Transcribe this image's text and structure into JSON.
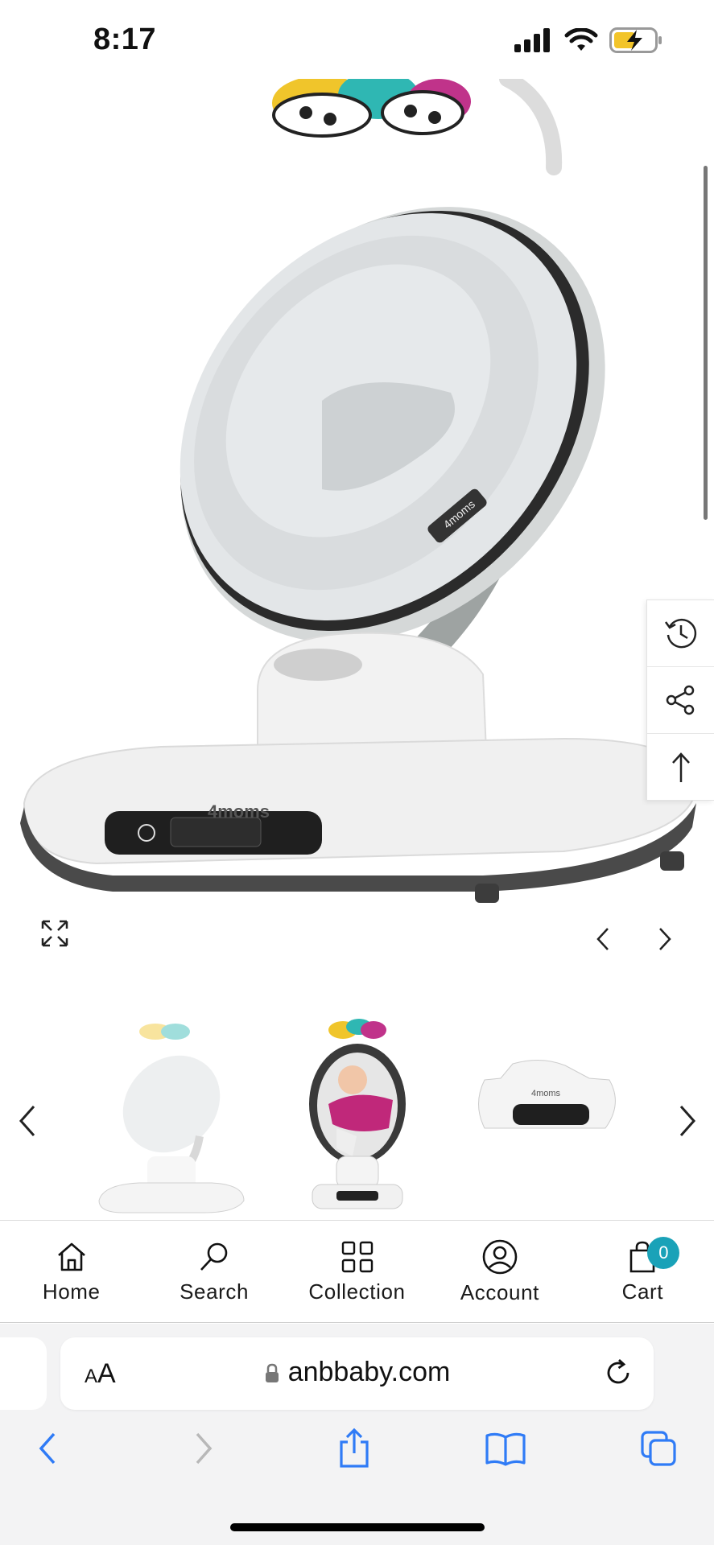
{
  "status_bar": {
    "time": "8:17"
  },
  "store_nav": {
    "items": [
      {
        "label": "Home",
        "icon": "home-icon"
      },
      {
        "label": "Search",
        "icon": "search-icon"
      },
      {
        "label": "Collection",
        "icon": "grid-icon"
      },
      {
        "label": "Account",
        "icon": "account-icon"
      },
      {
        "label": "Cart",
        "icon": "bag-icon"
      }
    ],
    "cart_count": "0",
    "badge_color": "#1aa2b8"
  },
  "browser": {
    "text_size_label_small": "A",
    "text_size_label_large": "A",
    "domain": "anbbaby.com"
  },
  "product_image": {
    "brand_mark": "4moms"
  },
  "colors": {
    "accent": "#1aa2b8",
    "safari_blue": "#2f7bf6"
  }
}
